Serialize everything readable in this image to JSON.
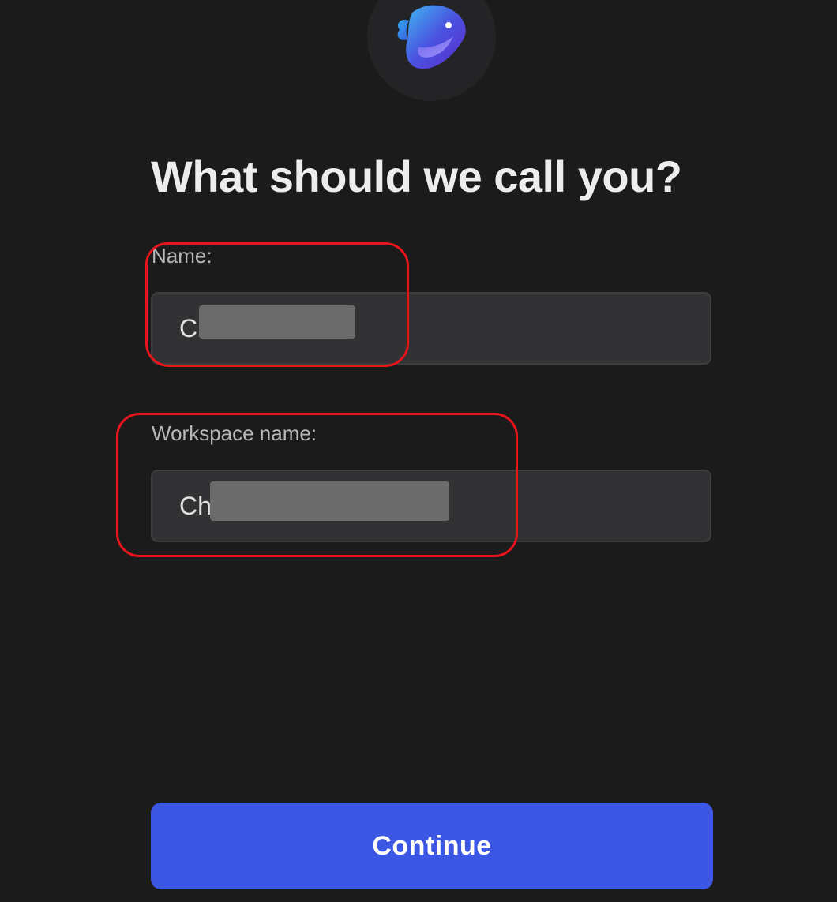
{
  "logo": {
    "icon": "fish-logo-icon",
    "colors": [
      "#3bb2f0",
      "#4a43dc",
      "#5b2fd0"
    ]
  },
  "heading": "What should we call you?",
  "name_field": {
    "label": "Name:",
    "value": "Ch        en",
    "redacted": true
  },
  "workspace_field": {
    "label": "Workspace name:",
    "value": "Ch                    ace",
    "redacted": true
  },
  "continue_button": {
    "label": "Continue",
    "color": "#3c57e3"
  },
  "annotation_color": "#e8141c"
}
